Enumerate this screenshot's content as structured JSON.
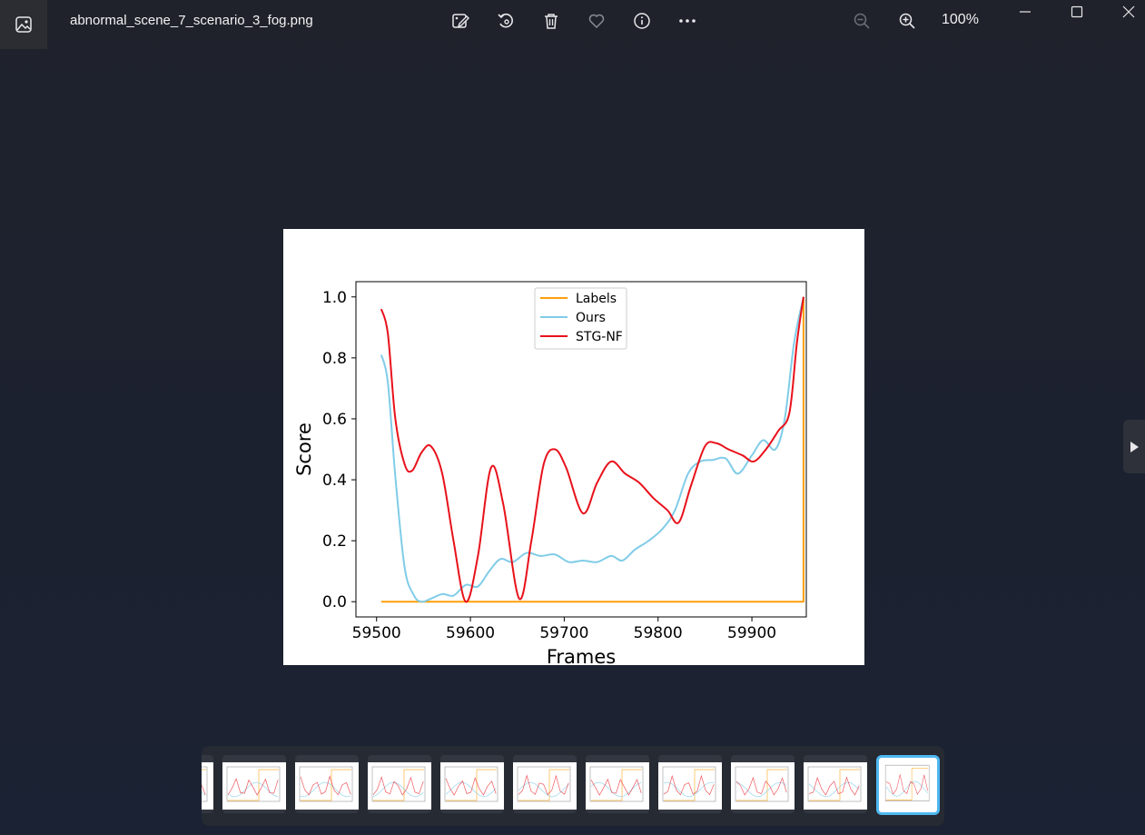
{
  "window": {
    "file_name": "abnormal_scene_7_scenario_3_fog.png",
    "zoom_level": "100%"
  },
  "toolbar": {
    "icons": [
      "edit-image-icon",
      "rotate-icon",
      "delete-icon",
      "favorite-icon",
      "info-icon",
      "more-icon"
    ],
    "zoom_icons": [
      "zoom-out-icon",
      "zoom-in-icon"
    ]
  },
  "colors": {
    "labels": "#ff9f0a",
    "ours": "#80cce8",
    "stg_nf": "#e8111b",
    "accent": "#4fb8f0"
  },
  "chart_data": {
    "type": "line",
    "xlabel": "Frames",
    "ylabel": "Score",
    "xlim": [
      59478,
      59958
    ],
    "ylim": [
      -0.05,
      1.05
    ],
    "xticks": [
      "59500",
      "59600",
      "59700",
      "59800",
      "59900"
    ],
    "yticks": [
      "0.0",
      "0.2",
      "0.4",
      "0.6",
      "0.8",
      "1.0"
    ],
    "legend_position": "upper-center",
    "series": [
      {
        "name": "Labels",
        "color_key": "labels",
        "x": [
          59505,
          59955,
          59955
        ],
        "y": [
          0.0,
          0.0,
          1.0
        ]
      },
      {
        "name": "Ours",
        "color_key": "ours",
        "x": [
          59505,
          59512,
          59520,
          59530,
          59540,
          59548,
          59558,
          59570,
          59582,
          59595,
          59608,
          59620,
          59632,
          59645,
          59660,
          59675,
          59690,
          59705,
          59720,
          59735,
          59750,
          59762,
          59775,
          59790,
          59805,
          59818,
          59832,
          59845,
          59858,
          59872,
          59885,
          59900,
          59912,
          59925,
          59935,
          59945,
          59955
        ],
        "y": [
          0.81,
          0.72,
          0.41,
          0.11,
          0.02,
          0.0,
          0.01,
          0.025,
          0.02,
          0.055,
          0.05,
          0.1,
          0.14,
          0.13,
          0.16,
          0.15,
          0.155,
          0.13,
          0.135,
          0.13,
          0.15,
          0.135,
          0.17,
          0.2,
          0.24,
          0.3,
          0.42,
          0.46,
          0.465,
          0.47,
          0.42,
          0.48,
          0.53,
          0.5,
          0.6,
          0.85,
          1.0
        ]
      },
      {
        "name": "STG-NF",
        "color_key": "stg_nf",
        "x": [
          59505,
          59512,
          59520,
          59530,
          59538,
          59548,
          59558,
          59570,
          59582,
          59595,
          59608,
          59622,
          59635,
          59652,
          59665,
          59678,
          59690,
          59702,
          59720,
          59735,
          59750,
          59765,
          59780,
          59795,
          59810,
          59822,
          59835,
          59850,
          59862,
          59875,
          59890,
          59902,
          59915,
          59928,
          59940,
          59948,
          59955
        ],
        "y": [
          0.96,
          0.88,
          0.6,
          0.45,
          0.43,
          0.49,
          0.51,
          0.42,
          0.2,
          0.0,
          0.15,
          0.44,
          0.32,
          0.01,
          0.2,
          0.45,
          0.5,
          0.44,
          0.29,
          0.39,
          0.46,
          0.42,
          0.39,
          0.34,
          0.3,
          0.26,
          0.38,
          0.51,
          0.52,
          0.5,
          0.48,
          0.46,
          0.5,
          0.56,
          0.62,
          0.85,
          1.0
        ]
      }
    ]
  },
  "filmstrip": {
    "count": 11,
    "active_index": 10
  }
}
